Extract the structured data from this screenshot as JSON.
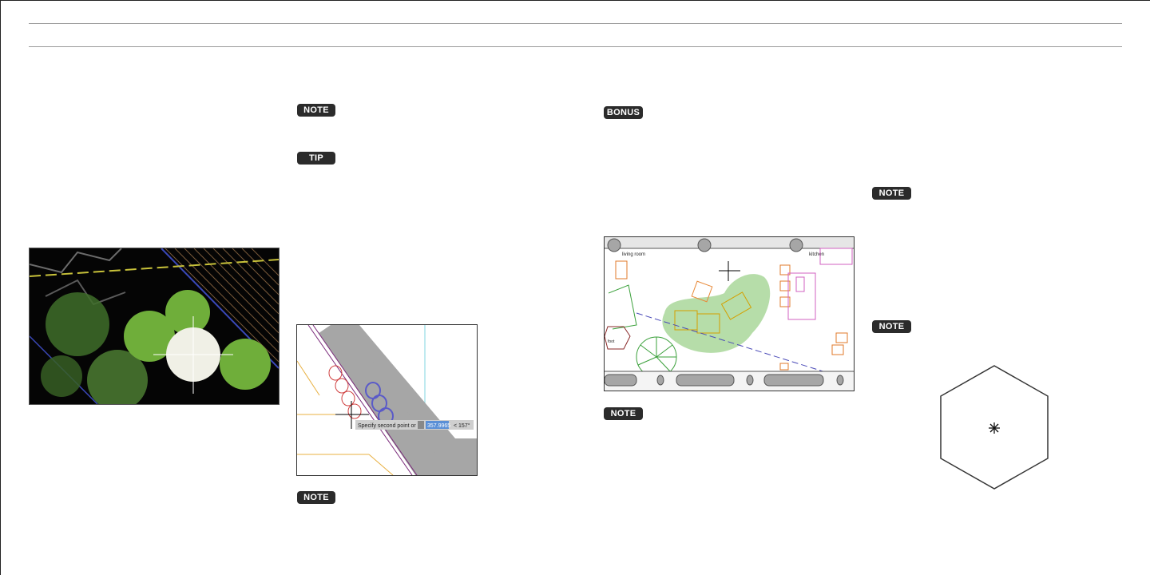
{
  "badges": {
    "note": "NOTE",
    "tip": "TIP",
    "bonus": "BONUS"
  },
  "figure_cad": {
    "tooltip_prompt": "Specify second point or",
    "tooltip_value": "357.9965",
    "tooltip_angle": "< 157°"
  },
  "figure_plan": {
    "room_living": "living room",
    "room_kitchen": "kitchen",
    "room_foot": "foot"
  },
  "colors": {
    "badge_bg": "#2b2b2b",
    "tree_green": "#6fae3a",
    "tree_selected": "#f0f0e6",
    "hatch_green": "#a9d79a",
    "wall_gray": "#a6a6a6"
  }
}
